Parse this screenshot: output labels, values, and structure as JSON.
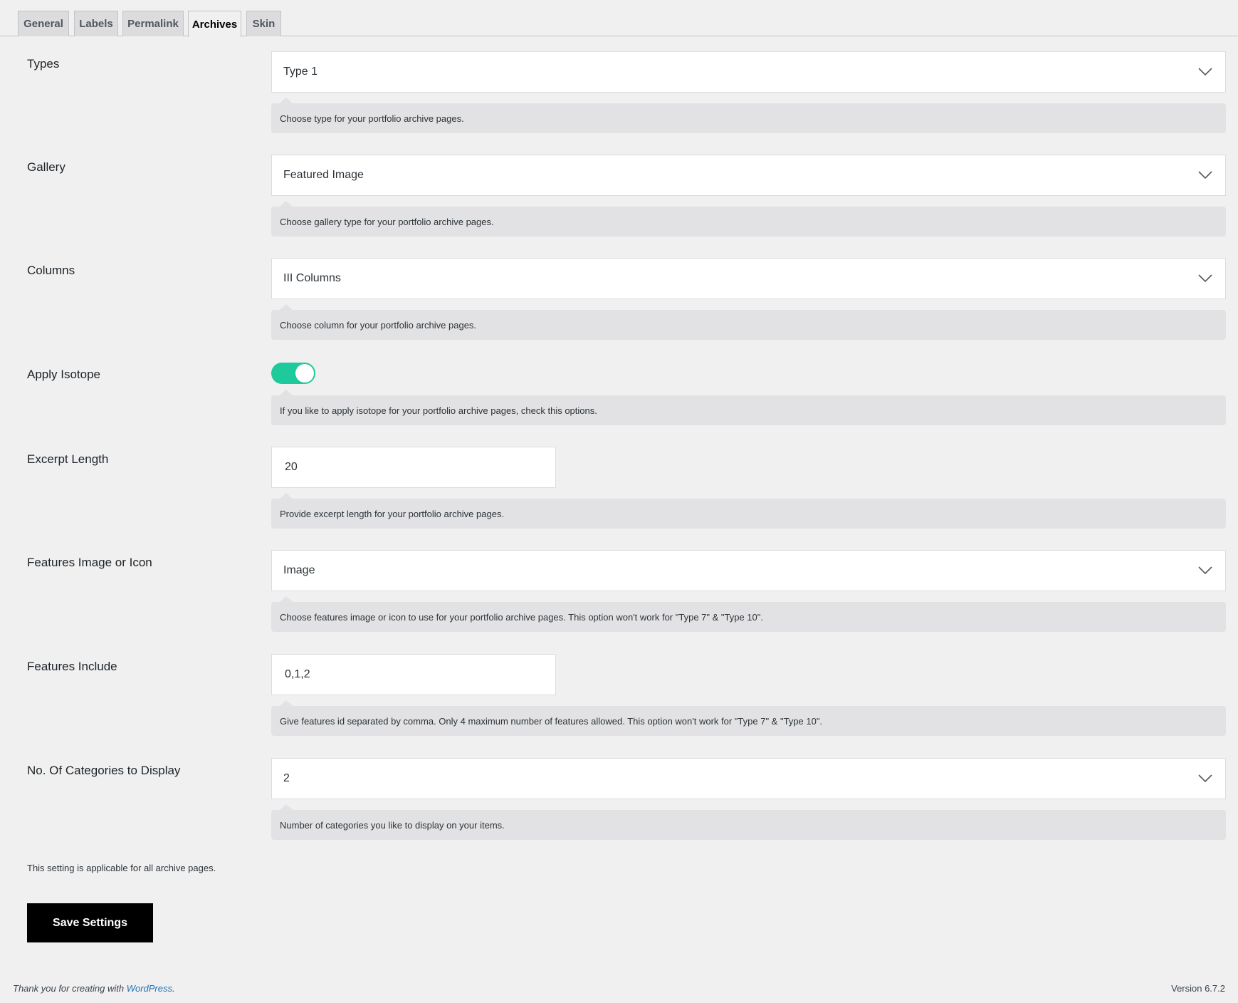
{
  "tabs": [
    {
      "label": "General"
    },
    {
      "label": "Labels"
    },
    {
      "label": "Permalink"
    },
    {
      "label": "Archives",
      "active": true
    },
    {
      "label": "Skin"
    }
  ],
  "fields": {
    "types": {
      "label": "Types",
      "value": "Type 1",
      "description": "Choose type for your portfolio archive pages."
    },
    "gallery": {
      "label": "Gallery",
      "value": "Featured Image",
      "description": "Choose gallery type for your portfolio archive pages."
    },
    "columns": {
      "label": "Columns",
      "value": "III Columns",
      "description": "Choose column for your portfolio archive pages."
    },
    "isotope": {
      "label": "Apply Isotope",
      "checked": true,
      "description": "If you like to apply isotope for your portfolio archive pages, check this options."
    },
    "excerpt": {
      "label": "Excerpt Length",
      "value": "20",
      "description": "Provide excerpt length for your portfolio archive pages."
    },
    "features_image": {
      "label": "Features Image or Icon",
      "value": "Image",
      "description": "Choose features image or icon to use for your portfolio archive pages. This option won't work for \"Type 7\" & \"Type 10\"."
    },
    "features_include": {
      "label": "Features Include",
      "value": "0,1,2",
      "description": "Give features id separated by comma. Only 4 maximum number of features allowed. This option won't work for \"Type 7\" & \"Type 10\"."
    },
    "categories": {
      "label": "No. Of Categories to Display",
      "value": "2",
      "description": "Number of categories you like to display on your items."
    }
  },
  "note": "This setting is applicable for all archive pages.",
  "save_label": "Save Settings",
  "footer": {
    "thanks_prefix": "Thank you for creating with ",
    "link": "WordPress",
    "suffix": ".",
    "version": "Version 6.7.2"
  },
  "colors": {
    "toggle_on": "#1ec99c",
    "link": "#2271b1"
  }
}
